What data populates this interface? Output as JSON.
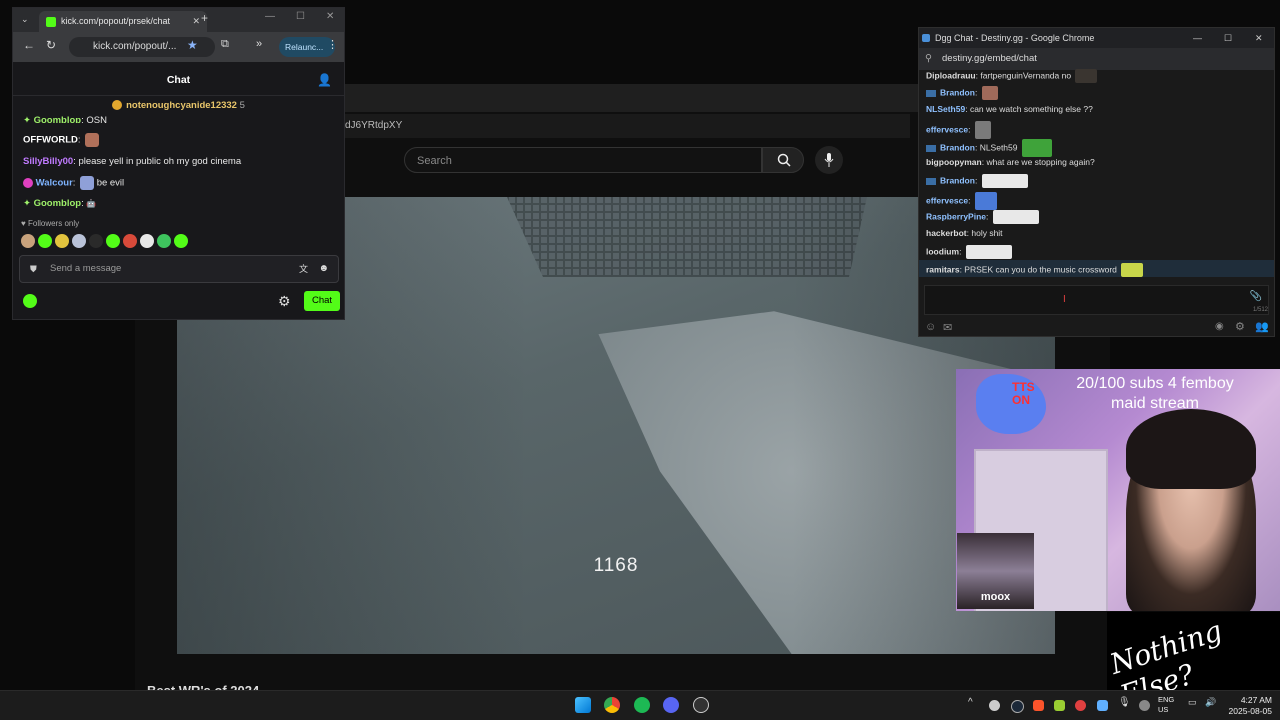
{
  "youtube": {
    "url_fragment": "dJ6YRtdpXY",
    "search_placeholder": "Search",
    "video_counter": "1168",
    "below_title": "Best WR's of 2024"
  },
  "kick": {
    "tab_title": "kick.com/popout/prsek/chat",
    "url": "kick.com/popout/...",
    "relaunch_label": "Relaunc...",
    "chat_title": "Chat",
    "pinned_user": "notenoughcyanide12332",
    "pinned_count": "5",
    "messages": [
      {
        "user": "Goomblop",
        "text": "OSN",
        "color": "#9ef06a"
      },
      {
        "user": "OFFWORLD",
        "text": "",
        "color": "#ffffff"
      },
      {
        "user": "SillyBilly00",
        "text": "please yell in public oh my god cinema",
        "color": "#c07bff"
      },
      {
        "user": "Walcour",
        "text": "be evil",
        "color": "#7fb4ff"
      },
      {
        "user": "Goomblop",
        "text": "",
        "color": "#9ef06a"
      }
    ],
    "followers_only": "Followers only",
    "input_placeholder": "Send a message",
    "send_label": "Chat"
  },
  "dgg": {
    "window_title": "Dgg Chat - Destiny.gg - Google Chrome",
    "url": "destiny.gg/embed/chat",
    "messages": [
      {
        "user": "Diploadrauu",
        "text": "fartpenguinVernanda no",
        "color": "#e8e8e8"
      },
      {
        "user": "Brandon",
        "text": "",
        "color": "#8fc1ff"
      },
      {
        "user": "NLSeth59",
        "text": "can we watch something else ??",
        "color": "#8fc1ff"
      },
      {
        "user": "effervesce",
        "text": "",
        "color": "#8fc1ff"
      },
      {
        "user": "Brandon",
        "text": "NLSeth59",
        "color": "#8fc1ff"
      },
      {
        "user": "bigpoopyman",
        "text": "what are we stopping again?",
        "color": "#e8e8e8"
      },
      {
        "user": "Brandon",
        "text": "",
        "color": "#8fc1ff"
      },
      {
        "user": "effervesce",
        "text": "",
        "color": "#8fc1ff"
      },
      {
        "user": "RaspberryPine",
        "text": "",
        "color": "#8fc1ff"
      },
      {
        "user": "hackerbot",
        "text": "holy shit",
        "color": "#e8e8e8"
      },
      {
        "user": "loodium",
        "text": "",
        "color": "#e8e8e8"
      },
      {
        "user": "ramitars",
        "text": "PRSEK can you do the music crossword",
        "color": "#e8e8e8"
      }
    ],
    "char_count": "1/512"
  },
  "overlay": {
    "tts": "TTS ON",
    "subs_line1": "20/100 subs 4 femboy",
    "subs_line2": "maid stream",
    "cam_name": "moox",
    "nothing_else": "Nothing Else?"
  },
  "taskbar": {
    "lang1": "ENG",
    "lang2": "US",
    "time": "4:27 AM",
    "date": "2025-08-05"
  }
}
